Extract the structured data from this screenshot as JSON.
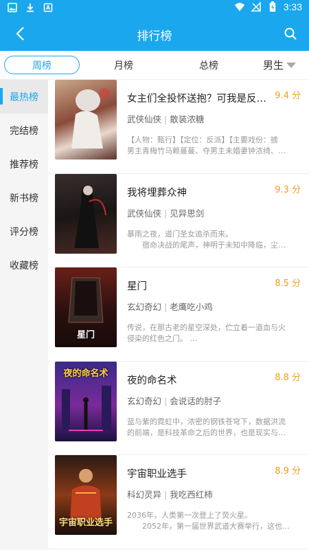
{
  "status": {
    "time": "3:33"
  },
  "appbar": {
    "title": "排行榜"
  },
  "tabs": [
    {
      "label": "周榜",
      "active": true
    },
    {
      "label": "月榜"
    },
    {
      "label": "总榜"
    },
    {
      "label": "男生"
    }
  ],
  "sidebar": {
    "items": [
      {
        "label": "最热榜",
        "active": true
      },
      {
        "label": "完结榜"
      },
      {
        "label": "推荐榜"
      },
      {
        "label": "新书榜"
      },
      {
        "label": "评分榜"
      },
      {
        "label": "收藏榜"
      }
    ]
  },
  "books": [
    {
      "title": "女主们全投怀送抱？可我是反…",
      "score": "9.4 分",
      "genre": "武侠仙侠",
      "author": "散装浓糖",
      "desc1": "【人物：甄行】【定位：反派】【主要戏份：掳",
      "desc2": "男主青梅竹马赖蔓蔓、夺男主未婚妻钟浓绮、…",
      "cover_text": ""
    },
    {
      "title": "我将埋葬众神",
      "score": "9.3 分",
      "genre": "武侠仙侠",
      "author": "见异思剑",
      "desc1": "暴雨之夜，道门圣女追杀而来。",
      "desc2": "　　宿命决战的尾声，神明于未知中降临，尘…",
      "cover_text": ""
    },
    {
      "title": "星门",
      "score": "8.5 分",
      "genre": "玄幻奇幻",
      "author": "老鹰吃小鸡",
      "desc1": "传说，在那古老的星空深处，伫立着一道血与火",
      "desc2": "侵染的红色之门。 …",
      "cover_text": "星门"
    },
    {
      "title": "夜的命名术",
      "score": "8.8 分",
      "genre": "玄幻奇幻",
      "author": "会说话的肘子",
      "desc1": "蓝与紫的霓虹中，浓密的钢铁苍穹下，数据洪流",
      "desc2": "的前端，是科技革命之后的世界，也是现实与…",
      "cover_text": "夜的命名术"
    },
    {
      "title": "宇宙职业选手",
      "score": "8.9 分",
      "genre": "科幻灵异",
      "author": "我吃西红柿",
      "desc1": "2036年，人类第一次登上了荧火星。",
      "desc2": "　　2052年，第一届世界武道大赛举行，这也…",
      "cover_text": "宇宙职业选手"
    }
  ],
  "colors": {
    "accent": "#1aa7ee",
    "score": "#f0a020"
  }
}
